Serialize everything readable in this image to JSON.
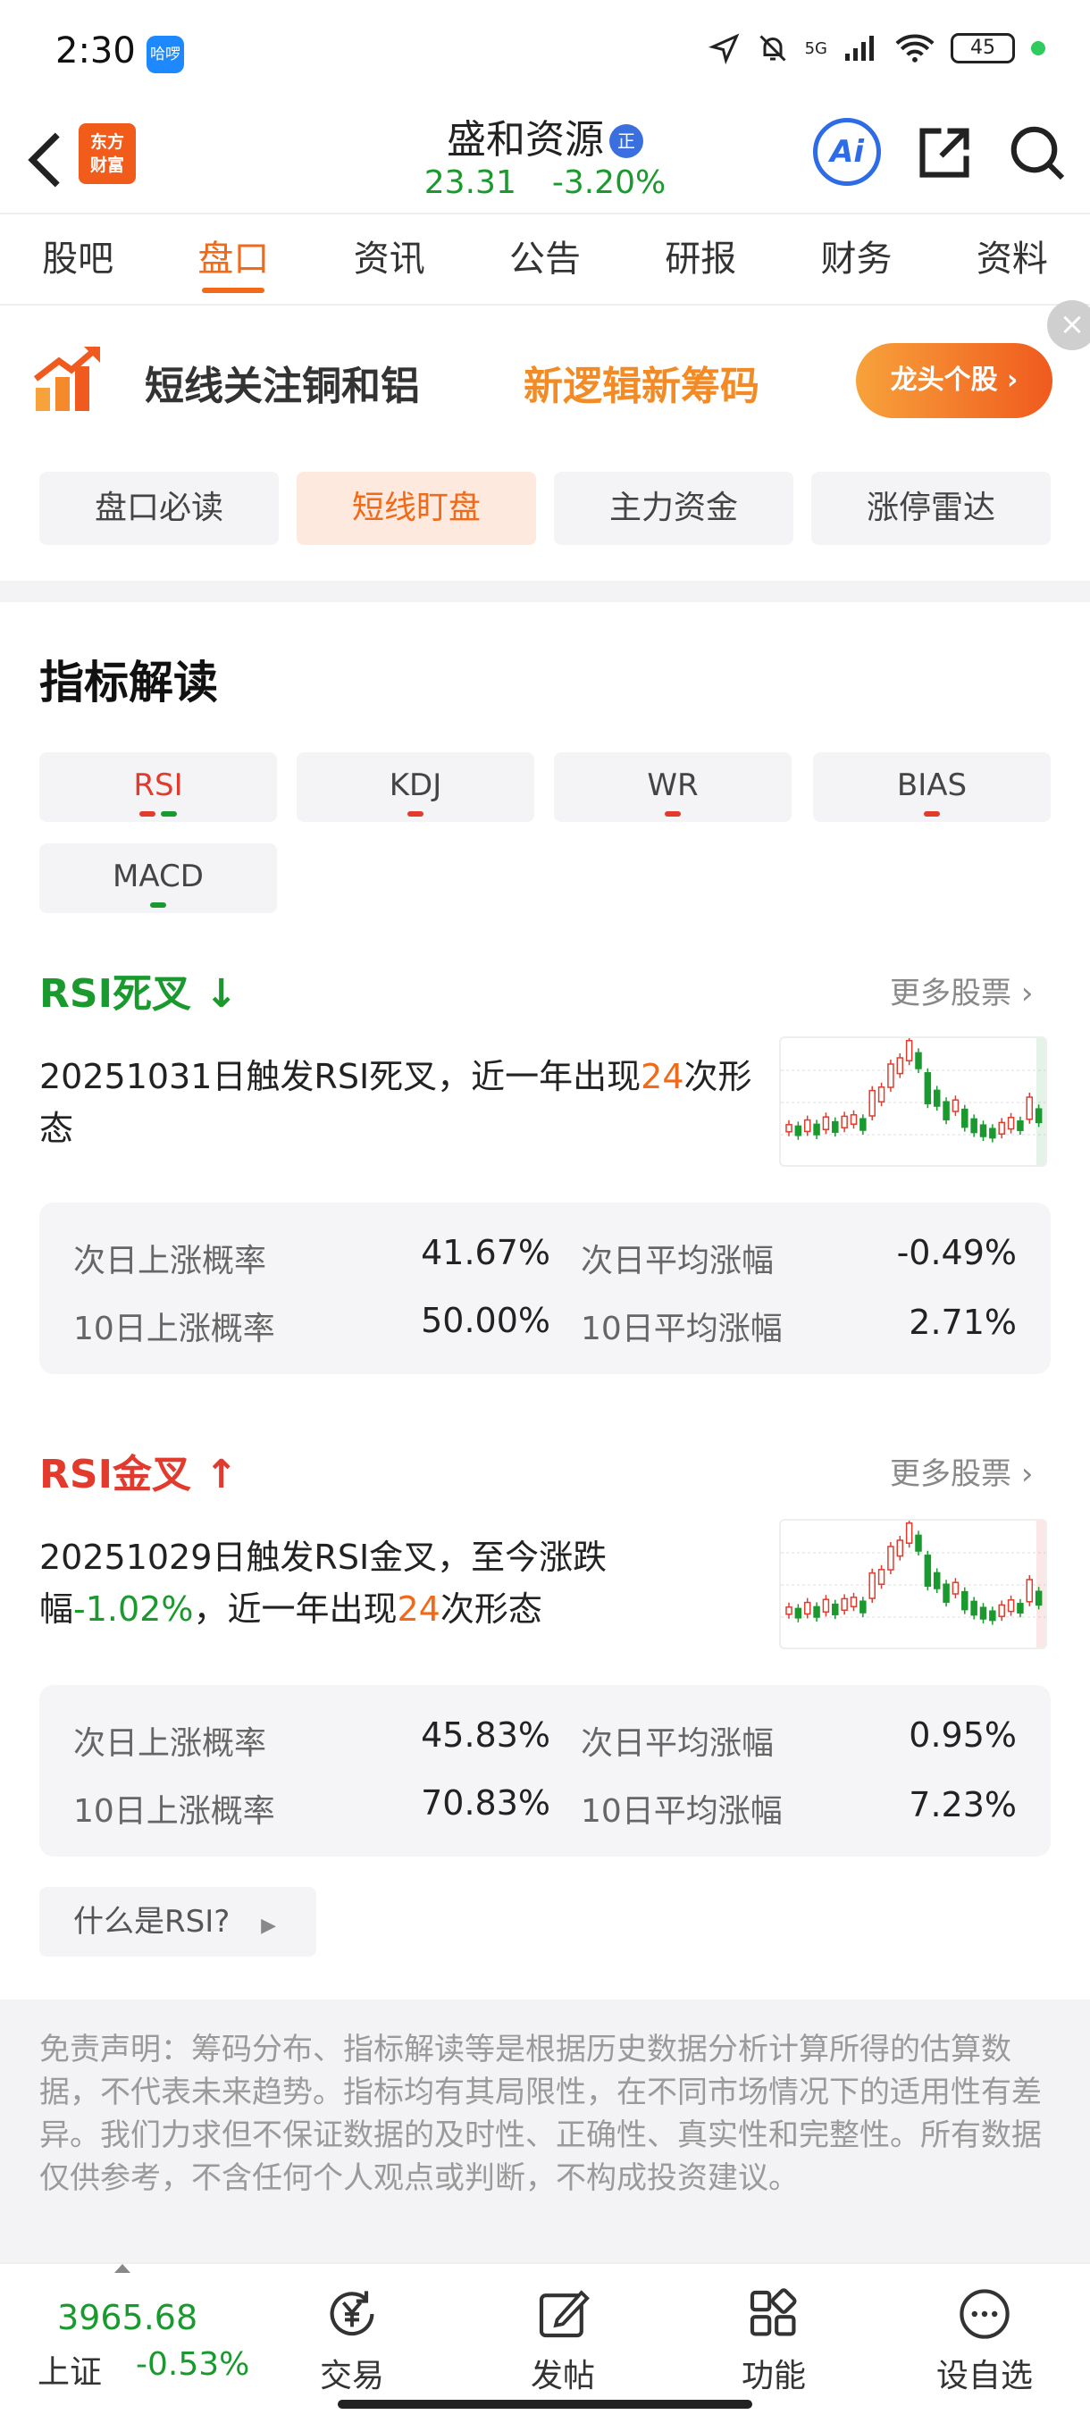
{
  "status": {
    "time": "2:30",
    "app_badge": "哈啰",
    "network": "5G",
    "battery": "45"
  },
  "header": {
    "stock_name": "盛和资源",
    "badge": "正",
    "price": "23.31",
    "change": "-3.20%",
    "logo_line1": "东方",
    "logo_line2": "财富",
    "ai_label": "Ai"
  },
  "tabs": [
    {
      "label": "股吧"
    },
    {
      "label": "盘口"
    },
    {
      "label": "资讯"
    },
    {
      "label": "公告"
    },
    {
      "label": "研报"
    },
    {
      "label": "财务"
    },
    {
      "label": "资料"
    }
  ],
  "banner": {
    "text1": "短线关注铜和铝",
    "text2": "新逻辑新筹码",
    "button": "龙头个股 ›"
  },
  "subtabs": [
    {
      "label": "盘口必读"
    },
    {
      "label": "短线盯盘"
    },
    {
      "label": "主力资金"
    },
    {
      "label": "涨停雷达"
    }
  ],
  "section_title": "指标解读",
  "indicators": [
    {
      "label": "RSI"
    },
    {
      "label": "KDJ"
    },
    {
      "label": "WR"
    },
    {
      "label": "BIAS"
    },
    {
      "label": "MACD"
    }
  ],
  "signals": [
    {
      "title": "RSI死叉",
      "arrow": "↓",
      "more": "更多股票",
      "desc_part1": "20251031日触发RSI死叉，近一年出现",
      "desc_count": "24",
      "desc_part2": "次形态",
      "stats": {
        "l1": "次日上涨概率",
        "v1": "41.67%",
        "l2": "次日平均涨幅",
        "v2": "-0.49%",
        "l3": "10日上涨概率",
        "v3": "50.00%",
        "l4": "10日平均涨幅",
        "v4": "2.71%"
      }
    },
    {
      "title": "RSI金叉",
      "arrow": "↑",
      "more": "更多股票",
      "desc_part1": "20251029日触发RSI金叉，至今涨跌幅",
      "desc_pct": "-1.02%",
      "desc_part2": "，近一年出现",
      "desc_count": "24",
      "desc_part3": "次形态",
      "stats": {
        "l1": "次日上涨概率",
        "v1": "45.83%",
        "l2": "次日平均涨幅",
        "v2": "0.95%",
        "l3": "10日上涨概率",
        "v3": "70.83%",
        "l4": "10日平均涨幅",
        "v4": "7.23%"
      }
    }
  ],
  "what_rsi": "什么是RSI?",
  "disclaimer": "免责声明：筹码分布、指标解读等是根据历史数据分析计算所得的估算数据，不代表未来趋势。指标均有其局限性，在不同市场情况下的适用性有差异。我们力求但不保证数据的及时性、正确性、真实性和完整性。所有数据仅供参考，不含任何个人观点或判断，不构成投资建议。",
  "bottom_nav": {
    "index_value": "3965.68",
    "index_name": "上证",
    "index_change": "-0.53%",
    "items": [
      {
        "label": "交易"
      },
      {
        "label": "发帖"
      },
      {
        "label": "功能"
      },
      {
        "label": "设自选"
      }
    ]
  },
  "colors": {
    "accent": "#f06a1a",
    "up": "#e23b2e",
    "down": "#1a9a2e",
    "ai_blue": "#2e6be6"
  }
}
